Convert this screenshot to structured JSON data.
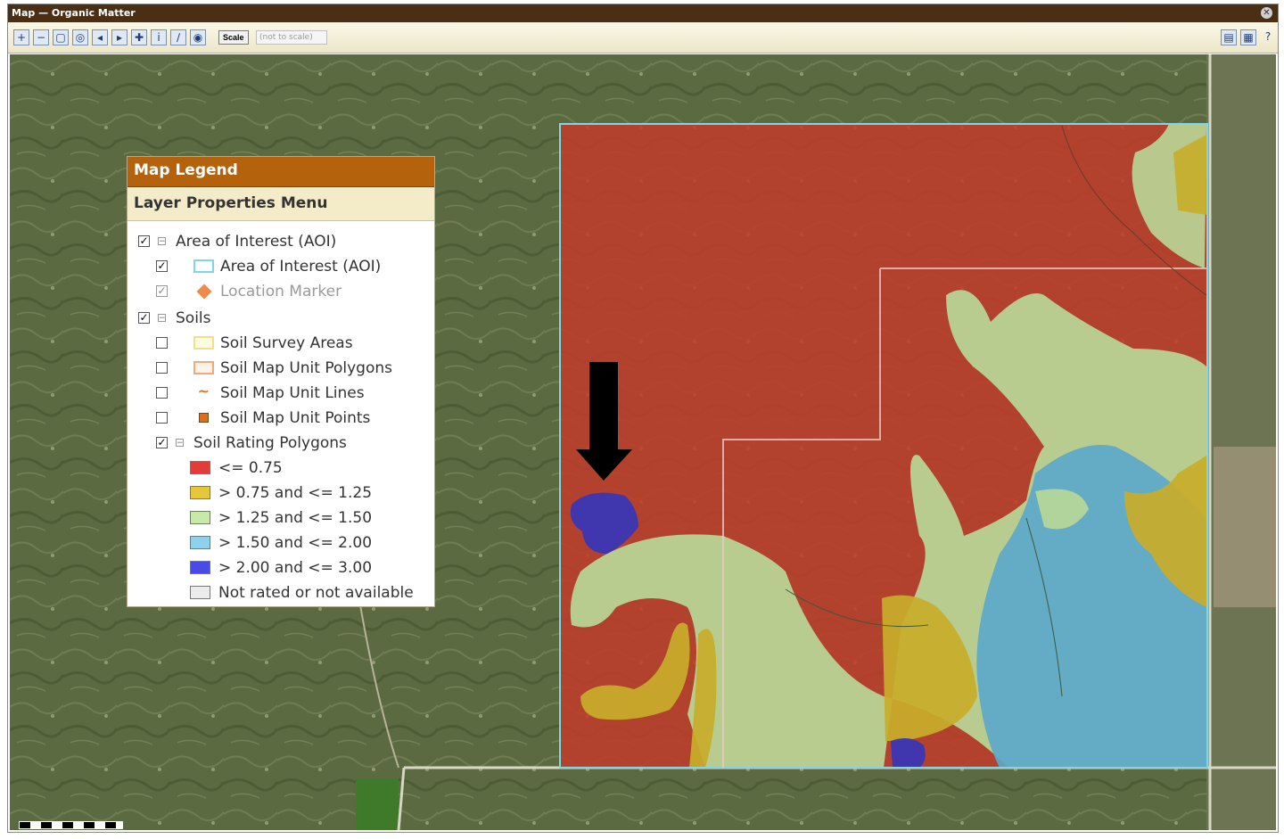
{
  "window": {
    "title": "Map — Organic Matter"
  },
  "toolbar": {
    "tools": [
      {
        "name": "zoom-in-icon",
        "glyph": "+"
      },
      {
        "name": "zoom-out-icon",
        "glyph": "−"
      },
      {
        "name": "zoom-extent-icon",
        "glyph": "▢"
      },
      {
        "name": "full-extent-icon",
        "glyph": "◎"
      },
      {
        "name": "previous-extent-icon",
        "glyph": "◂"
      },
      {
        "name": "next-extent-icon",
        "glyph": "▸"
      },
      {
        "name": "pan-icon",
        "glyph": "✚"
      },
      {
        "name": "identify-icon",
        "glyph": "i"
      },
      {
        "name": "measure-icon",
        "glyph": "∕"
      },
      {
        "name": "define-aoi-icon",
        "glyph": "◉"
      }
    ],
    "scale_button": "Scale",
    "scale_select": "(not to scale)"
  },
  "legend": {
    "title": "Map Legend",
    "subtitle": "Layer Properties Menu",
    "groups": [
      {
        "label": "Area of Interest (AOI)",
        "checked": true,
        "items": [
          {
            "label": "Area of Interest (AOI)",
            "checked": true,
            "swatch": "aoi"
          },
          {
            "label": "Location Marker",
            "checked": true,
            "disabled": true,
            "swatch": "marker"
          }
        ]
      },
      {
        "label": "Soils",
        "checked": true,
        "items": [
          {
            "label": "Soil Survey Areas",
            "checked": false,
            "swatch": "survey"
          },
          {
            "label": "Soil Map Unit Polygons",
            "checked": false,
            "swatch": "polygons"
          },
          {
            "label": "Soil Map Unit Lines",
            "checked": false,
            "swatch": "lines"
          },
          {
            "label": "Soil Map Unit Points",
            "checked": false,
            "swatch": "points"
          },
          {
            "label": "Soil Rating Polygons",
            "checked": true,
            "swatch": "none"
          }
        ]
      }
    ],
    "ratings": [
      {
        "label": "<= 0.75",
        "color": "#e23b3b"
      },
      {
        "label": "> 0.75 and <= 1.25",
        "color": "#e6c63a"
      },
      {
        "label": "> 1.25 and <= 1.50",
        "color": "#c8eaa8"
      },
      {
        "label": "> 1.50 and <= 2.00",
        "color": "#8fd0ec"
      },
      {
        "label": "> 2.00 and <= 3.00",
        "color": "#4a4ae6"
      },
      {
        "label": "Not rated or not available",
        "color": "#ececec"
      }
    ]
  },
  "colors": {
    "red_class": "#c23a2a",
    "yellow_class": "#c8ad2a",
    "green_class": "#b9d898",
    "blue_class": "#5ea8c9",
    "purple_class": "#3a36b5",
    "aoi_border": "#7fd6e6",
    "arrow": "#000000"
  }
}
